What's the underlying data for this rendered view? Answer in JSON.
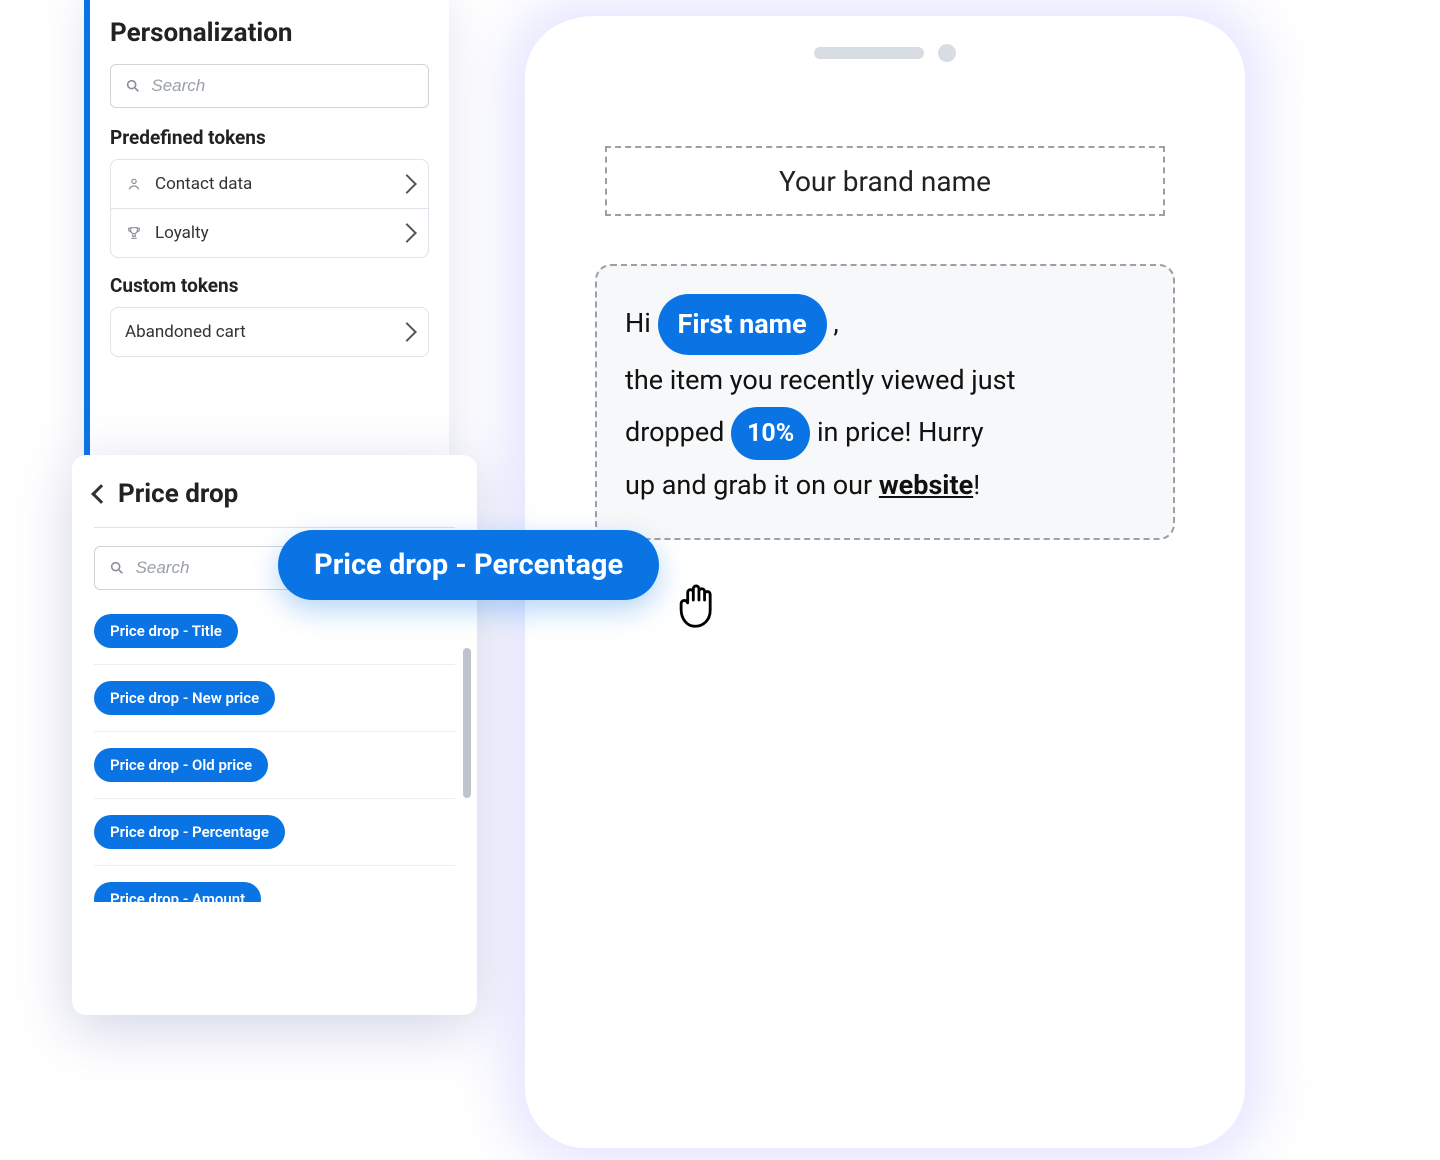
{
  "panel": {
    "title": "Personalization",
    "search_placeholder": "Search",
    "predefined_label": "Predefined tokens",
    "predefined_items": [
      {
        "label": "Contact data",
        "icon": "person"
      },
      {
        "label": "Loyalty",
        "icon": "trophy"
      }
    ],
    "custom_label": "Custom tokens",
    "custom_items": [
      {
        "label": "Abandoned cart"
      }
    ]
  },
  "subpanel": {
    "title": "Price drop",
    "search_placeholder": "Search",
    "tokens": [
      "Price drop - Title",
      "Price drop - New price",
      "Price drop - Old price",
      "Price drop - Percentage",
      "Price drop - Amount"
    ]
  },
  "drag_label": "Price drop - Percentage",
  "phone": {
    "brand_placeholder": "Your brand name",
    "msg_hi": "Hi",
    "msg_firstname": "First name",
    "msg_comma": ",",
    "msg_line1": "the item you recently viewed just",
    "msg_dropped": "dropped",
    "msg_percent": "10%",
    "msg_inprice": "in price! Hurry",
    "msg_grab": "up and grab it on our",
    "msg_website": "website",
    "msg_excl": "!"
  }
}
